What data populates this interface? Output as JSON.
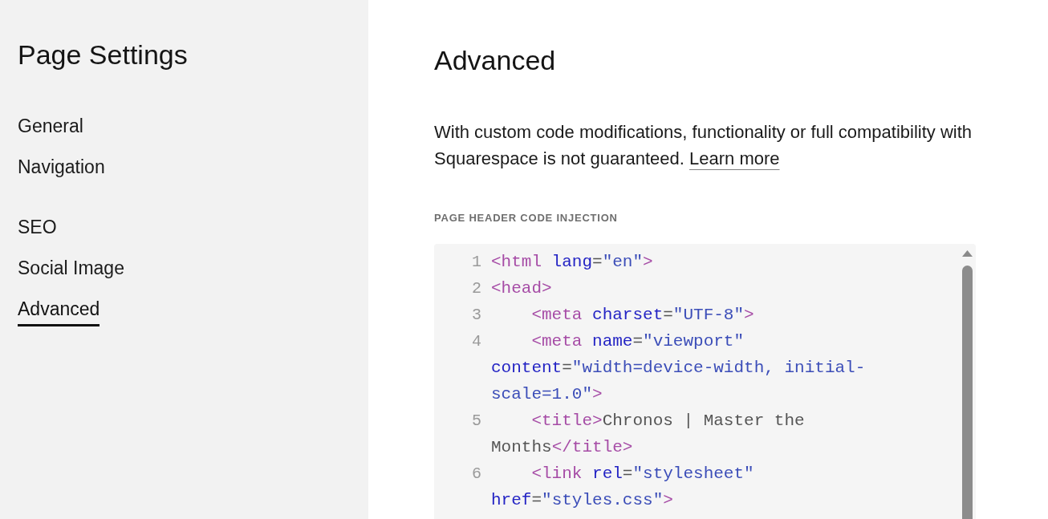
{
  "sidebar": {
    "title": "Page Settings",
    "groups": [
      {
        "items": [
          {
            "label": "General",
            "selected": false
          },
          {
            "label": "Navigation",
            "selected": false
          }
        ]
      },
      {
        "items": [
          {
            "label": "SEO",
            "selected": false
          },
          {
            "label": "Social Image",
            "selected": false
          },
          {
            "label": "Advanced",
            "selected": true
          }
        ]
      }
    ]
  },
  "main": {
    "title": "Advanced",
    "notice": {
      "text": "With custom code modifications, functionality or full compatibility with Squarespace is not guaranteed.",
      "link": "Learn more"
    },
    "code_injection": {
      "label": "PAGE HEADER CODE INJECTION",
      "lines": [
        {
          "number": "1",
          "rows": [
            {
              "tokens": [
                {
                  "kind": "tag",
                  "text": "<html"
                },
                {
                  "kind": "attr",
                  "text": " lang"
                },
                {
                  "kind": "punct",
                  "text": "="
                },
                {
                  "kind": "string",
                  "text": "\"en\""
                },
                {
                  "kind": "tag",
                  "text": ">"
                }
              ]
            }
          ]
        },
        {
          "number": "2",
          "rows": [
            {
              "tokens": [
                {
                  "kind": "tag",
                  "text": "<head>"
                }
              ]
            }
          ]
        },
        {
          "number": "3",
          "rows": [
            {
              "tokens": [
                {
                  "kind": "tag",
                  "text": "    <meta"
                },
                {
                  "kind": "attr",
                  "text": " charset"
                },
                {
                  "kind": "punct",
                  "text": "="
                },
                {
                  "kind": "string",
                  "text": "\"UTF-8\""
                },
                {
                  "kind": "tag",
                  "text": ">"
                }
              ]
            }
          ]
        },
        {
          "number": "4",
          "rows": [
            {
              "tokens": [
                {
                  "kind": "tag",
                  "text": "    <meta"
                },
                {
                  "kind": "attr",
                  "text": " name"
                },
                {
                  "kind": "punct",
                  "text": "="
                },
                {
                  "kind": "string",
                  "text": "\"viewport\""
                }
              ]
            },
            {
              "tokens": [
                {
                  "kind": "attr",
                  "text": "content"
                },
                {
                  "kind": "punct",
                  "text": "="
                },
                {
                  "kind": "string",
                  "text": "\"width=device-width, initial-"
                }
              ]
            },
            {
              "tokens": [
                {
                  "kind": "string",
                  "text": "scale=1.0\""
                },
                {
                  "kind": "tag",
                  "text": ">"
                }
              ]
            }
          ]
        },
        {
          "number": "5",
          "rows": [
            {
              "tokens": [
                {
                  "kind": "tag",
                  "text": "    <title>"
                },
                {
                  "kind": "text",
                  "text": "Chronos | Master the"
                }
              ]
            },
            {
              "tokens": [
                {
                  "kind": "text",
                  "text": "Months"
                },
                {
                  "kind": "tag",
                  "text": "</title>"
                }
              ]
            }
          ]
        },
        {
          "number": "6",
          "rows": [
            {
              "tokens": [
                {
                  "kind": "tag",
                  "text": "    <link"
                },
                {
                  "kind": "attr",
                  "text": " rel"
                },
                {
                  "kind": "punct",
                  "text": "="
                },
                {
                  "kind": "string",
                  "text": "\"stylesheet\""
                }
              ]
            },
            {
              "tokens": [
                {
                  "kind": "attr",
                  "text": "href"
                },
                {
                  "kind": "punct",
                  "text": "="
                },
                {
                  "kind": "string",
                  "text": "\"styles.css\""
                },
                {
                  "kind": "tag",
                  "text": ">"
                }
              ]
            }
          ]
        }
      ]
    }
  }
}
